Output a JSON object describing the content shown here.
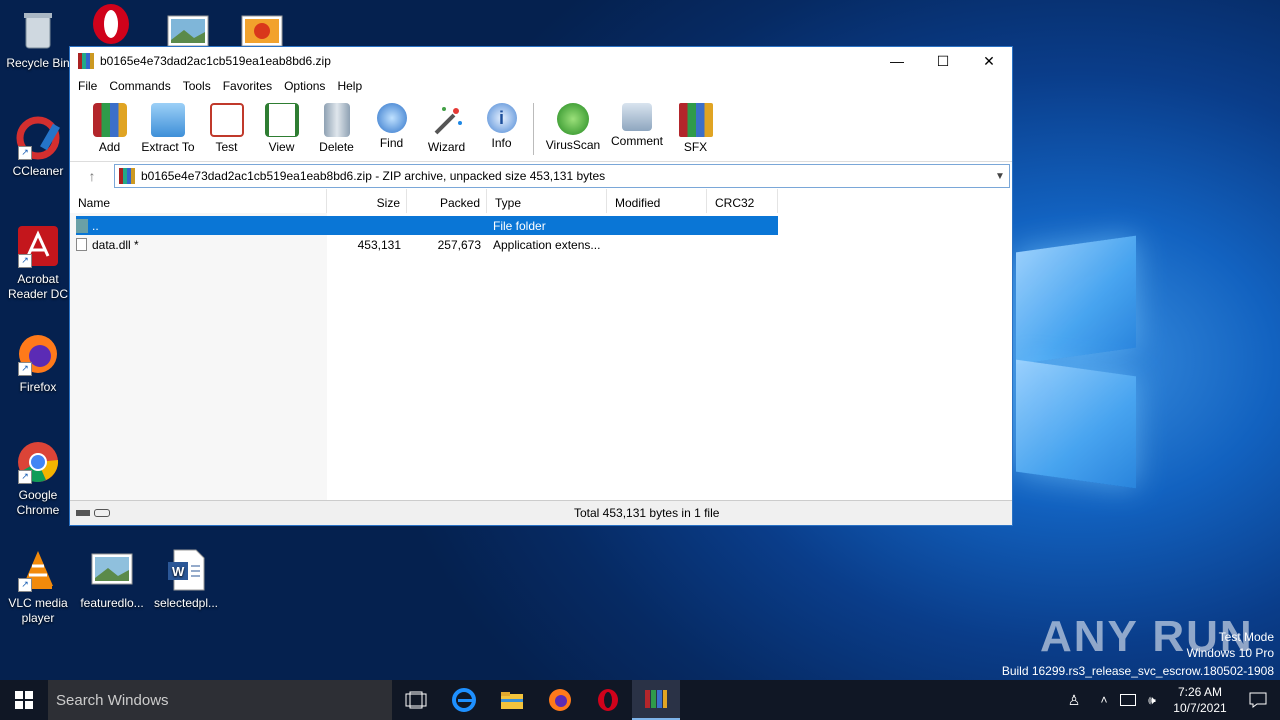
{
  "desktop": {
    "icons": [
      {
        "label": "Recycle Bin"
      },
      {
        "label": "CCleaner"
      },
      {
        "label": "Acrobat Reader DC"
      },
      {
        "label": "Firefox"
      },
      {
        "label": "Google Chrome"
      },
      {
        "label": "VLC media player"
      },
      {
        "label": "featuredlo..."
      },
      {
        "label": "selectedpl..."
      }
    ]
  },
  "window": {
    "title": "b0165e4e73dad2ac1cb519ea1eab8bd6.zip",
    "controls": {
      "minimize": "—",
      "maximize": "☐",
      "close": "✕"
    },
    "menu": [
      "File",
      "Commands",
      "Tools",
      "Favorites",
      "Options",
      "Help"
    ],
    "toolbar": [
      {
        "label": "Add",
        "icon": "add-icon"
      },
      {
        "label": "Extract To",
        "icon": "extract-icon"
      },
      {
        "label": "Test",
        "icon": "test-icon"
      },
      {
        "label": "View",
        "icon": "view-icon"
      },
      {
        "label": "Delete",
        "icon": "delete-icon"
      },
      {
        "label": "Find",
        "icon": "find-icon"
      },
      {
        "label": "Wizard",
        "icon": "wizard-icon"
      },
      {
        "label": "Info",
        "icon": "info-icon"
      },
      {
        "label": "VirusScan",
        "icon": "virusscan-icon"
      },
      {
        "label": "Comment",
        "icon": "comment-icon"
      },
      {
        "label": "SFX",
        "icon": "sfx-icon"
      }
    ],
    "address": "b0165e4e73dad2ac1cb519ea1eab8bd6.zip - ZIP archive, unpacked size 453,131 bytes",
    "columns": [
      "Name",
      "Size",
      "Packed",
      "Type",
      "Modified",
      "CRC32"
    ],
    "rows": [
      {
        "name": "..",
        "size": "",
        "packed": "",
        "type": "File folder",
        "modified": "",
        "crc": ""
      },
      {
        "name": "data.dll *",
        "size": "453,131",
        "packed": "257,673",
        "type": "Application extens...",
        "modified": "",
        "crc": ""
      }
    ],
    "status": "Total 453,131 bytes in 1 file"
  },
  "taskbar": {
    "search_placeholder": "Search Windows",
    "time": "7:26 AM",
    "date": "10/7/2021"
  },
  "watermark": {
    "brand": "ANY RUN",
    "line1": "Test Mode",
    "line2": "Windows 10 Pro",
    "line3": "Build 16299.rs3_release_svc_escrow.180502-1908"
  },
  "colors": {
    "selection": "#0a76d6",
    "desktop": "#0a3d8a",
    "taskbar": "#101725"
  }
}
